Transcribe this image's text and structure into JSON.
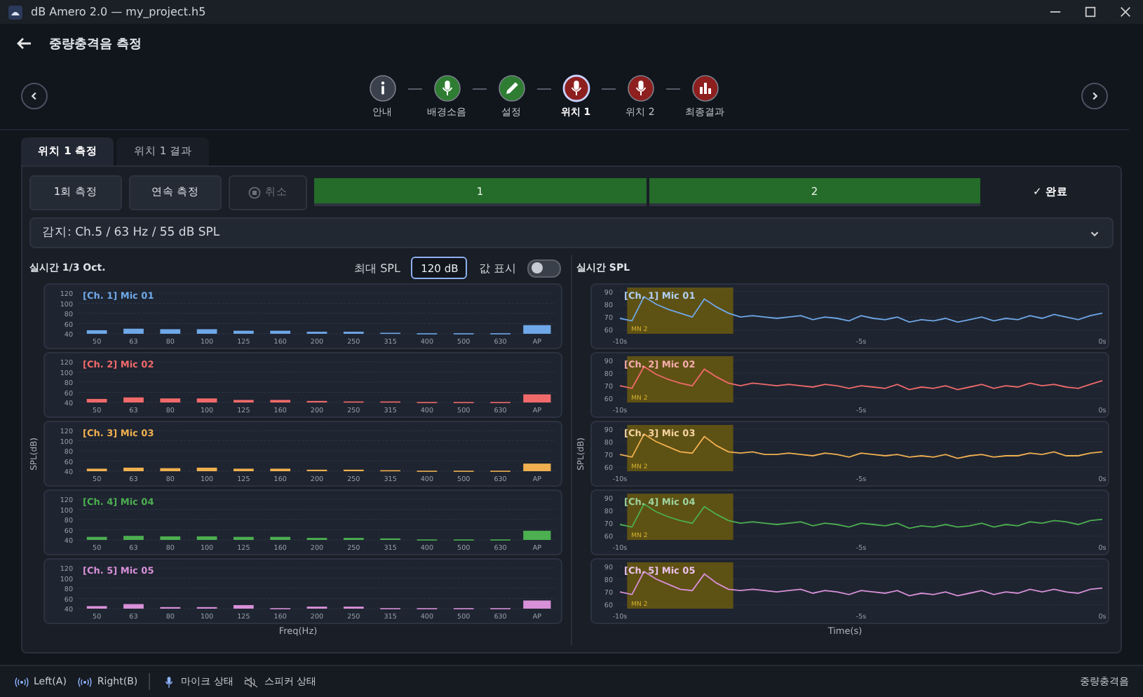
{
  "window": {
    "title": "dB Amero 2.0 — my_project.h5"
  },
  "header": {
    "title": "중량충격음 측정"
  },
  "steps": [
    {
      "label": "안내",
      "kind": "info",
      "color": "#3a414d",
      "selected": false
    },
    {
      "label": "배경소음",
      "kind": "mic",
      "color": "#2e7d32",
      "selected": false
    },
    {
      "label": "설정",
      "kind": "pencil",
      "color": "#2e7d32",
      "selected": false
    },
    {
      "label": "위치 1",
      "kind": "mic",
      "color": "#8e1f1f",
      "selected": true
    },
    {
      "label": "위치 2",
      "kind": "mic",
      "color": "#8e1f1f",
      "selected": false
    },
    {
      "label": "최종결과",
      "kind": "chart",
      "color": "#8e1f1f",
      "selected": false
    }
  ],
  "tabs": [
    {
      "label": "위치 1 측정",
      "selected": true
    },
    {
      "label": "위치 1 결과",
      "selected": false
    }
  ],
  "actions": [
    {
      "label": "1회 측정",
      "kind": "plain",
      "disabled": false
    },
    {
      "label": "연속 측정",
      "kind": "plain",
      "disabled": false
    },
    {
      "label": "취소",
      "kind": "stop",
      "disabled": true
    }
  ],
  "segments": [
    {
      "label": "1",
      "done": true
    },
    {
      "label": "2",
      "done": true
    }
  ],
  "finish": "✓ 완료",
  "detect": {
    "value": "감지: Ch.5 / 63 Hz / 55 dB SPL"
  },
  "left": {
    "title": "실시간 1/3 Oct.",
    "max_label": "최대 SPL",
    "max_value": "120 dB",
    "toggle_label": "값 표시",
    "toggle_on": false,
    "ylabel": "SPL(dB)",
    "xlabel": "Freq(Hz)",
    "charts": [
      {
        "chart_data": {
          "type": "bar",
          "title": "[Ch. 1] Mic 01",
          "grid": true,
          "categories": [
            "50",
            "63",
            "80",
            "100",
            "125",
            "160",
            "200",
            "250",
            "315",
            "400",
            "500",
            "630",
            "AP"
          ],
          "ylim": [
            40,
            120
          ],
          "yticks": [
            40,
            60,
            80,
            100,
            120
          ],
          "series": [
            {
              "color": "#6fa8e8",
              "values": [
                47,
                50,
                49,
                49,
                46,
                46,
                44,
                44,
                42,
                41,
                41,
                41,
                57
              ]
            }
          ]
        }
      },
      {
        "chart_data": {
          "type": "bar",
          "title": "[Ch. 2] Mic 02",
          "grid": true,
          "categories": [
            "50",
            "63",
            "80",
            "100",
            "125",
            "160",
            "200",
            "250",
            "315",
            "400",
            "500",
            "630",
            "AP"
          ],
          "ylim": [
            40,
            120
          ],
          "yticks": [
            40,
            60,
            80,
            100,
            120
          ],
          "series": [
            {
              "color": "#f06a6a",
              "values": [
                47,
                50,
                48,
                48,
                45,
                45,
                43,
                42,
                42,
                41,
                41,
                41,
                56
              ]
            }
          ]
        }
      },
      {
        "chart_data": {
          "type": "bar",
          "title": "[Ch. 3] Mic 03",
          "grid": true,
          "categories": [
            "50",
            "63",
            "80",
            "100",
            "125",
            "160",
            "200",
            "250",
            "315",
            "400",
            "500",
            "630",
            "AP"
          ],
          "ylim": [
            40,
            120
          ],
          "yticks": [
            40,
            60,
            80,
            100,
            120
          ],
          "series": [
            {
              "color": "#f0b050",
              "values": [
                45,
                47,
                46,
                47,
                45,
                45,
                43,
                43,
                42,
                41,
                41,
                41,
                55
              ]
            }
          ]
        }
      },
      {
        "chart_data": {
          "type": "bar",
          "title": "[Ch. 4] Mic 04",
          "grid": true,
          "categories": [
            "50",
            "63",
            "80",
            "100",
            "125",
            "160",
            "200",
            "250",
            "315",
            "400",
            "500",
            "630",
            "AP"
          ],
          "ylim": [
            40,
            120
          ],
          "yticks": [
            40,
            60,
            80,
            100,
            120
          ],
          "series": [
            {
              "color": "#4caf50",
              "values": [
                46,
                48,
                47,
                47,
                46,
                46,
                44,
                44,
                43,
                41,
                41,
                41,
                58
              ]
            }
          ]
        }
      },
      {
        "chart_data": {
          "type": "bar",
          "title": "[Ch. 5] Mic 05",
          "grid": true,
          "categories": [
            "50",
            "63",
            "80",
            "100",
            "125",
            "160",
            "200",
            "250",
            "315",
            "400",
            "500",
            "630",
            "AP"
          ],
          "ylim": [
            40,
            120
          ],
          "yticks": [
            40,
            60,
            80,
            100,
            120
          ],
          "series": [
            {
              "color": "#d890d8",
              "values": [
                45,
                49,
                43,
                43,
                47,
                41,
                44,
                44,
                41,
                41,
                41,
                41,
                56
              ]
            }
          ]
        }
      }
    ]
  },
  "right": {
    "title": "실시간 SPL",
    "ylabel": "SPL(dB)",
    "xlabel": "Time(s)",
    "charts": [
      {
        "chart_data": {
          "type": "line",
          "title": "[Ch. 1] Mic 01",
          "grid": true,
          "bands": [
            {
              "axis": "x",
              "from": -9.85,
              "to": -7.65,
              "label": "MN 2"
            }
          ],
          "x": [
            -10,
            -9.75,
            -9.5,
            -9.25,
            -9,
            -8.75,
            -8.5,
            -8.25,
            -8,
            -7.75,
            -7.5,
            -7.25,
            -7,
            -6.75,
            -6.5,
            -6.25,
            -6,
            -5.75,
            -5.5,
            -5.25,
            -5,
            -4.75,
            -4.5,
            -4.25,
            -4,
            -3.75,
            -3.5,
            -3.25,
            -3,
            -2.75,
            -2.5,
            -2.25,
            -2,
            -1.75,
            -1.5,
            -1.25,
            -1,
            -0.75,
            -0.5,
            -0.25,
            0
          ],
          "xlim": [
            -10,
            0
          ],
          "ylim": [
            58,
            92
          ],
          "yticks": [
            60,
            70,
            80,
            90
          ],
          "xticks": [
            {
              "value": -10,
              "label": "-10s"
            },
            {
              "value": -5,
              "label": "-5s"
            },
            {
              "value": 0,
              "label": "0s"
            }
          ],
          "series": [
            {
              "color": "#6fa8e8",
              "values": [
                69,
                67,
                86,
                80,
                76,
                73,
                70,
                84,
                78,
                73,
                70,
                71,
                70,
                69,
                70,
                71,
                68,
                70,
                69,
                67,
                71,
                69,
                68,
                70,
                66,
                68,
                67,
                69,
                66,
                68,
                70,
                67,
                69,
                68,
                71,
                69,
                72,
                70,
                68,
                71,
                73
              ]
            }
          ]
        }
      },
      {
        "chart_data": {
          "type": "line",
          "title": "[Ch. 2] Mic 02",
          "grid": true,
          "bands": [
            {
              "axis": "x",
              "from": -9.85,
              "to": -7.65,
              "label": "MN 2"
            }
          ],
          "x": [
            -10,
            -9.75,
            -9.5,
            -9.25,
            -9,
            -8.75,
            -8.5,
            -8.25,
            -8,
            -7.75,
            -7.5,
            -7.25,
            -7,
            -6.75,
            -6.5,
            -6.25,
            -6,
            -5.75,
            -5.5,
            -5.25,
            -5,
            -4.75,
            -4.5,
            -4.25,
            -4,
            -3.75,
            -3.5,
            -3.25,
            -3,
            -2.75,
            -2.5,
            -2.25,
            -2,
            -1.75,
            -1.5,
            -1.25,
            -1,
            -0.75,
            -0.5,
            -0.25,
            0
          ],
          "xlim": [
            -10,
            0
          ],
          "ylim": [
            58,
            92
          ],
          "yticks": [
            60,
            70,
            80,
            90
          ],
          "xticks": [
            {
              "value": -10,
              "label": "-10s"
            },
            {
              "value": -5,
              "label": "-5s"
            },
            {
              "value": 0,
              "label": "0s"
            }
          ],
          "series": [
            {
              "color": "#f06a6a",
              "values": [
                70,
                68,
                85,
                79,
                75,
                72,
                70,
                83,
                77,
                72,
                70,
                72,
                71,
                70,
                71,
                70,
                69,
                71,
                70,
                68,
                70,
                69,
                68,
                71,
                67,
                69,
                68,
                70,
                67,
                69,
                71,
                68,
                70,
                69,
                72,
                70,
                71,
                69,
                68,
                71,
                74
              ]
            }
          ]
        }
      },
      {
        "chart_data": {
          "type": "line",
          "title": "[Ch. 3] Mic 03",
          "grid": true,
          "bands": [
            {
              "axis": "x",
              "from": -9.85,
              "to": -7.65,
              "label": "MN 2"
            }
          ],
          "x": [
            -10,
            -9.75,
            -9.5,
            -9.25,
            -9,
            -8.75,
            -8.5,
            -8.25,
            -8,
            -7.75,
            -7.5,
            -7.25,
            -7,
            -6.75,
            -6.5,
            -6.25,
            -6,
            -5.75,
            -5.5,
            -5.25,
            -5,
            -4.75,
            -4.5,
            -4.25,
            -4,
            -3.75,
            -3.5,
            -3.25,
            -3,
            -2.75,
            -2.5,
            -2.25,
            -2,
            -1.75,
            -1.5,
            -1.25,
            -1,
            -0.75,
            -0.5,
            -0.25,
            0
          ],
          "xlim": [
            -10,
            0
          ],
          "ylim": [
            58,
            92
          ],
          "yticks": [
            60,
            70,
            80,
            90
          ],
          "xticks": [
            {
              "value": -10,
              "label": "-10s"
            },
            {
              "value": -5,
              "label": "-5s"
            },
            {
              "value": 0,
              "label": "0s"
            }
          ],
          "series": [
            {
              "color": "#f0b050",
              "values": [
                70,
                68,
                86,
                80,
                76,
                72,
                71,
                84,
                77,
                72,
                71,
                72,
                70,
                70,
                71,
                70,
                69,
                71,
                70,
                68,
                71,
                70,
                69,
                70,
                68,
                69,
                68,
                70,
                67,
                69,
                70,
                68,
                69,
                69,
                71,
                70,
                72,
                69,
                69,
                71,
                72
              ]
            }
          ]
        }
      },
      {
        "chart_data": {
          "type": "line",
          "title": "[Ch. 4] Mic 04",
          "grid": true,
          "bands": [
            {
              "axis": "x",
              "from": -9.85,
              "to": -7.65,
              "label": "MN 2"
            }
          ],
          "x": [
            -10,
            -9.75,
            -9.5,
            -9.25,
            -9,
            -8.75,
            -8.5,
            -8.25,
            -8,
            -7.75,
            -7.5,
            -7.25,
            -7,
            -6.75,
            -6.5,
            -6.25,
            -6,
            -5.75,
            -5.5,
            -5.25,
            -5,
            -4.75,
            -4.5,
            -4.25,
            -4,
            -3.75,
            -3.5,
            -3.25,
            -3,
            -2.75,
            -2.5,
            -2.25,
            -2,
            -1.75,
            -1.5,
            -1.25,
            -1,
            -0.75,
            -0.5,
            -0.25,
            0
          ],
          "xlim": [
            -10,
            0
          ],
          "ylim": [
            58,
            92
          ],
          "yticks": [
            60,
            70,
            80,
            90
          ],
          "xticks": [
            {
              "value": -10,
              "label": "-10s"
            },
            {
              "value": -5,
              "label": "-5s"
            },
            {
              "value": 0,
              "label": "0s"
            }
          ],
          "series": [
            {
              "color": "#4caf50",
              "values": [
                69,
                67,
                85,
                79,
                75,
                72,
                70,
                83,
                77,
                72,
                70,
                71,
                70,
                69,
                70,
                71,
                68,
                70,
                69,
                67,
                70,
                69,
                68,
                70,
                66,
                68,
                67,
                69,
                67,
                68,
                70,
                67,
                69,
                68,
                71,
                70,
                72,
                71,
                69,
                72,
                73
              ]
            }
          ]
        }
      },
      {
        "chart_data": {
          "type": "line",
          "title": "[Ch. 5] Mic 05",
          "grid": true,
          "bands": [
            {
              "axis": "x",
              "from": -9.85,
              "to": -7.65,
              "label": "MN 2"
            }
          ],
          "x": [
            -10,
            -9.75,
            -9.5,
            -9.25,
            -9,
            -8.75,
            -8.5,
            -8.25,
            -8,
            -7.75,
            -7.5,
            -7.25,
            -7,
            -6.75,
            -6.5,
            -6.25,
            -6,
            -5.75,
            -5.5,
            -5.25,
            -5,
            -4.75,
            -4.5,
            -4.25,
            -4,
            -3.75,
            -3.5,
            -3.25,
            -3,
            -2.75,
            -2.5,
            -2.25,
            -2,
            -1.75,
            -1.5,
            -1.25,
            -1,
            -0.75,
            -0.5,
            -0.25,
            0
          ],
          "xlim": [
            -10,
            0
          ],
          "ylim": [
            58,
            92
          ],
          "yticks": [
            60,
            70,
            80,
            90
          ],
          "xticks": [
            {
              "value": -10,
              "label": "-10s"
            },
            {
              "value": -5,
              "label": "-5s"
            },
            {
              "value": 0,
              "label": "0s"
            }
          ],
          "series": [
            {
              "color": "#d890d8",
              "values": [
                70,
                68,
                86,
                80,
                76,
                72,
                71,
                84,
                77,
                72,
                71,
                72,
                71,
                70,
                71,
                72,
                69,
                71,
                70,
                68,
                71,
                70,
                69,
                71,
                67,
                69,
                68,
                70,
                67,
                69,
                71,
                68,
                70,
                69,
                72,
                70,
                72,
                70,
                69,
                72,
                73
              ]
            }
          ]
        }
      }
    ]
  },
  "status": {
    "items": [
      {
        "kind": "signal",
        "label": "Left(A)"
      },
      {
        "kind": "signal",
        "label": "Right(B)"
      },
      {
        "kind": "mic",
        "label": "마이크 상태"
      },
      {
        "kind": "speaker-off",
        "label": "스피커 상태"
      }
    ],
    "mode": "중량충격음"
  }
}
